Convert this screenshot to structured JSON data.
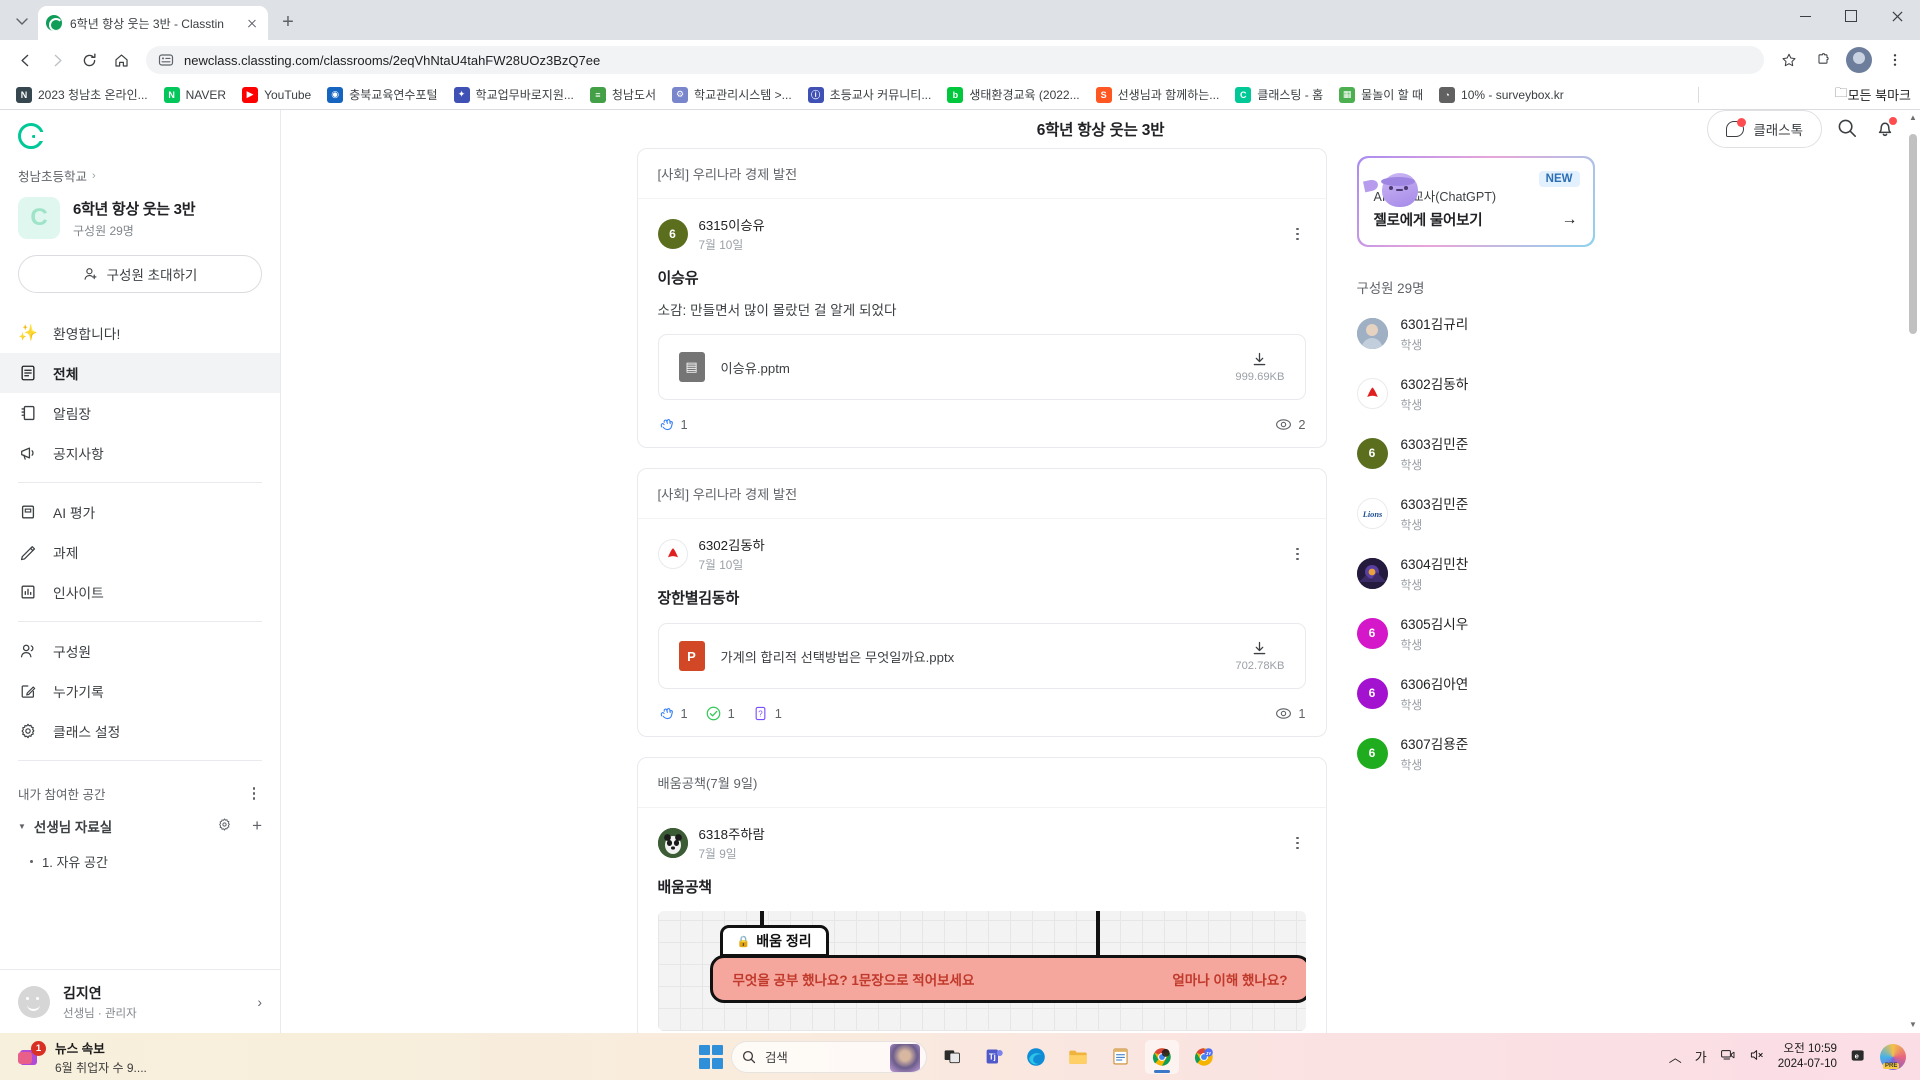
{
  "browser": {
    "tab": {
      "title": "6학년 항상 웃는 3반 - Classtin",
      "favicon": "classting-icon"
    },
    "newtab_label": "+",
    "url": "newclass.classting.com/classrooms/2eqVhNtaU4tahFW28UOz3BzQ7ee",
    "bookmarks": [
      {
        "label": "2023 청남초 온라인...",
        "icon": "note-icon",
        "color": "#37474f",
        "glyph": "N"
      },
      {
        "label": "NAVER",
        "icon": "naver-icon",
        "color": "#03c75a",
        "glyph": "N"
      },
      {
        "label": "YouTube",
        "icon": "youtube-icon",
        "color": "#ff0000",
        "glyph": "▶"
      },
      {
        "label": "충북교육연수포털",
        "icon": "portal-icon",
        "color": "#1565c0",
        "glyph": "◉"
      },
      {
        "label": "학교업무바로지원...",
        "icon": "school-icon",
        "color": "#3f51b5",
        "glyph": "✦"
      },
      {
        "label": "청남도서",
        "icon": "library-icon",
        "color": "#43a047",
        "glyph": "≡"
      },
      {
        "label": "학교관리시스템 >...",
        "icon": "sysadmin-icon",
        "color": "#7986cb",
        "glyph": "⚙"
      },
      {
        "label": "초등교사 커뮤니티...",
        "icon": "community-icon",
        "color": "#3f51b5",
        "glyph": "ⓘ"
      },
      {
        "label": "생태환경교육 (2022...",
        "icon": "blog-icon",
        "color": "#00c73c",
        "glyph": "b"
      },
      {
        "label": "선생님과 함께하는...",
        "icon": "s-icon",
        "color": "#ff5722",
        "glyph": "S"
      },
      {
        "label": "클래스팅 - 홈",
        "icon": "classting-icon",
        "color": "#00c896",
        "glyph": "C"
      },
      {
        "label": "물놀이 할 때",
        "icon": "grid-icon",
        "color": "#4caf50",
        "glyph": "▦"
      },
      {
        "label": "10% - surveybox.kr",
        "icon": "survey-icon",
        "color": "#616161",
        "glyph": "◔"
      }
    ],
    "all_bookmarks_label": "모든 북마크"
  },
  "sidebar": {
    "school": "청남초등학교",
    "class_name": "6학년 항상 웃는 3반",
    "class_members": "구성원 29명",
    "class_initial": "C",
    "invite_label": "구성원 초대하기",
    "nav_group1": [
      {
        "label": "환영합니다!",
        "icon": "sparkle-icon",
        "active": false
      },
      {
        "label": "전체",
        "icon": "list-icon",
        "active": true
      },
      {
        "label": "알림장",
        "icon": "notice-book-icon",
        "active": false
      },
      {
        "label": "공지사항",
        "icon": "megaphone-icon",
        "active": false
      }
    ],
    "nav_group2": [
      {
        "label": "AI 평가",
        "icon": "ai-assessment-icon",
        "active": false
      },
      {
        "label": "과제",
        "icon": "pencil-icon",
        "active": false
      },
      {
        "label": "인사이트",
        "icon": "chart-icon",
        "active": false
      }
    ],
    "nav_group3": [
      {
        "label": "구성원",
        "icon": "people-icon",
        "active": false
      },
      {
        "label": "누가기록",
        "icon": "record-icon",
        "active": false
      },
      {
        "label": "클래스 설정",
        "icon": "gear-icon",
        "active": false
      }
    ],
    "spaces_header": "내가 참여한 공간",
    "space_name": "선생님 자료실",
    "subspace_name": "1. 자유 공간",
    "user_name": "김지연",
    "user_role": "선생님 · 관리자"
  },
  "header": {
    "title": "6학년 항상 웃는 3반",
    "classtalk_label": "클래스톡"
  },
  "posts": [
    {
      "board": "[사회] 우리나라 경제 발전",
      "author": "6315이승유",
      "author_initial": "6",
      "author_color": "#5a6e1e",
      "date": "7월 10일",
      "title": "이승유",
      "text": "소감: 만들면서 많이 몰랐던 걸 알게 되었다",
      "file_name": "이승유.pptm",
      "file_size": "999.69KB",
      "file_type": "generic",
      "file_color": "#757575",
      "file_glyph": "▤",
      "reactions": [
        {
          "icon": "clap-icon",
          "count": "1"
        }
      ],
      "views": "2"
    },
    {
      "board": "[사회] 우리나라 경제 발전",
      "author": "6302김동하",
      "author_initial": "",
      "author_color": "#ffffff",
      "date": "7월 10일",
      "title": "장한별김동하",
      "text": "",
      "file_name": "가계의 합리적 선택방법은 무엇일까요.pptx",
      "file_size": "702.78KB",
      "file_type": "powerpoint",
      "file_color": "#d24726",
      "file_glyph": "P",
      "reactions": [
        {
          "icon": "clap-icon",
          "count": "1"
        },
        {
          "icon": "check-icon",
          "count": "1"
        },
        {
          "icon": "question-icon",
          "count": "1"
        }
      ],
      "views": "1"
    },
    {
      "board": "배움공책(7월 9일)",
      "author": "6318주하람",
      "author_initial": "",
      "author_color": "#2e4a2e",
      "date": "7월 9일",
      "title": "배움공책",
      "text": "",
      "image_tab_label": "배움 정리",
      "image_left_text": "무엇을 공부 했나요? 1문장으로 적어보세요",
      "image_right_text": "얼마나 이해 했나요?"
    }
  ],
  "rail": {
    "ai_badge": "NEW",
    "ai_subtitle": "AI 보조교사(ChatGPT)",
    "ai_title": "젤로에게 물어보기",
    "members_header": "구성원 29명",
    "members": [
      {
        "name": "6301김규리",
        "role": "학생",
        "initial": "",
        "color": "#8190a5",
        "photo": true
      },
      {
        "name": "6302김동하",
        "role": "학생",
        "initial": "",
        "color": "#ffffff",
        "photo": true
      },
      {
        "name": "6303김민준",
        "role": "학생",
        "initial": "6",
        "color": "#5a6e1e",
        "photo": false
      },
      {
        "name": "6303김민준",
        "role": "학생",
        "initial": "",
        "color": "#1d4f91",
        "photo": true
      },
      {
        "name": "6304김민찬",
        "role": "학생",
        "initial": "",
        "color": "#2b1d4a",
        "photo": true
      },
      {
        "name": "6305김시우",
        "role": "학생",
        "initial": "6",
        "color": "#d417c8",
        "photo": false
      },
      {
        "name": "6306김아연",
        "role": "학생",
        "initial": "6",
        "color": "#a312cf",
        "photo": false
      },
      {
        "name": "6307김용준",
        "role": "학생",
        "initial": "6",
        "color": "#1fad1f",
        "photo": false
      }
    ]
  },
  "taskbar": {
    "news_title": "뉴스 속보",
    "news_sub": "6월 취업자 수 9....",
    "news_badge": "1",
    "search_placeholder": "검색",
    "time": "오전 10:59",
    "date": "2024-07-10",
    "ime_label": "가",
    "apps": [
      {
        "name": "task-view-icon",
        "glyph": "▢"
      },
      {
        "name": "teams-icon",
        "glyph": "Tj"
      },
      {
        "name": "edge-icon",
        "glyph": "◉"
      },
      {
        "name": "file-explorer-icon",
        "glyph": "▤"
      },
      {
        "name": "notepad-icon",
        "glyph": "▥"
      },
      {
        "name": "chrome-icon",
        "glyph": "◎"
      },
      {
        "name": "chrome-profile-icon",
        "glyph": "◎"
      }
    ]
  }
}
